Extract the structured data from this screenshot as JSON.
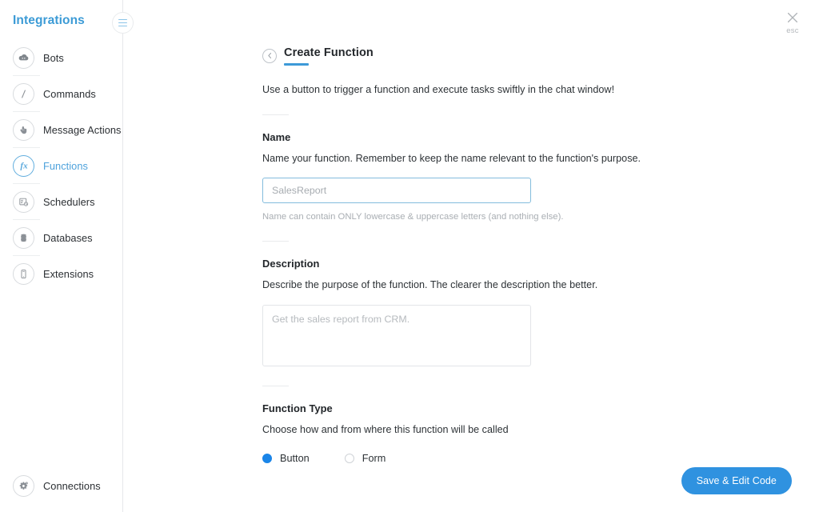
{
  "sidebar": {
    "title": "Integrations",
    "toggle_icon": "hamburger-menu-icon",
    "items": [
      {
        "label": "Bots",
        "icon": "cloud-bot-icon",
        "active": false
      },
      {
        "label": "Commands",
        "icon": "slash-command-icon",
        "active": false
      },
      {
        "label": "Message Actions",
        "icon": "pointer-hand-icon",
        "active": false
      },
      {
        "label": "Functions",
        "icon": "fx-function-icon",
        "active": true
      },
      {
        "label": "Schedulers",
        "icon": "calendar-clock-icon",
        "active": false
      },
      {
        "label": "Databases",
        "icon": "database-stack-icon",
        "active": false
      },
      {
        "label": "Extensions",
        "icon": "mobile-device-icon",
        "active": false
      }
    ],
    "bottom_items": [
      {
        "label": "Connections",
        "icon": "gear-connections-icon",
        "active": false
      }
    ]
  },
  "topbar": {
    "close_icon": "close-x-icon",
    "close_label": "esc"
  },
  "page": {
    "back_icon": "chevron-left-icon",
    "title": "Create Function",
    "subtitle": "Use a button to trigger a function and execute tasks swiftly in the chat window!"
  },
  "name_section": {
    "title": "Name",
    "description": "Name your function. Remember to keep the name relevant to the function's purpose.",
    "input_value": "",
    "input_placeholder": "SalesReport",
    "hint": "Name can contain ONLY lowercase & uppercase letters (and nothing else)."
  },
  "description_section": {
    "title": "Description",
    "description": "Describe the purpose of the function. The clearer the description the better.",
    "textarea_value": "",
    "textarea_placeholder": "Get the sales report from CRM."
  },
  "function_type_section": {
    "title": "Function Type",
    "description": "Choose how and from where this function will be called",
    "options": [
      {
        "label": "Button",
        "selected": true
      },
      {
        "label": "Form",
        "selected": false
      }
    ]
  },
  "actions": {
    "save_label": "Save & Edit Code"
  },
  "colors": {
    "accent_blue": "#3d9ad8",
    "primary_button": "#2f92e0",
    "radio_selected": "#1a85e8",
    "sidebar_title": "#3c9bd6",
    "input_focus_border": "#83bcdd"
  }
}
